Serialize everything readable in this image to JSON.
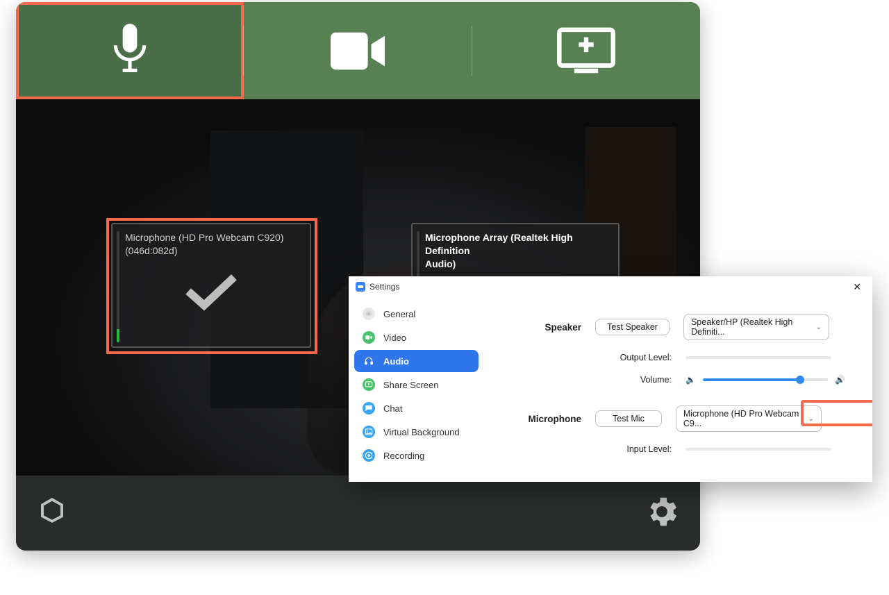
{
  "app": {
    "tabs": {
      "audio": "Audio",
      "video": "Video",
      "screen": "Add Screen"
    }
  },
  "mic_cards": {
    "left": {
      "line1": "Microphone (HD Pro Webcam C920)",
      "line2": "(046d:082d)"
    },
    "right": {
      "line1": "Microphone Array (Realtek High Definition",
      "line2": "Audio)"
    }
  },
  "settings": {
    "title": "Settings",
    "nav": {
      "general": "General",
      "video": "Video",
      "audio": "Audio",
      "share": "Share Screen",
      "chat": "Chat",
      "vbg": "Virtual Background",
      "recording": "Recording"
    },
    "speaker": {
      "label": "Speaker",
      "test_btn": "Test Speaker",
      "dropdown": "Speaker/HP (Realtek High Definiti...",
      "output_level_label": "Output Level:",
      "volume_label": "Volume:",
      "volume_percent": 78
    },
    "microphone": {
      "label": "Microphone",
      "test_btn": "Test Mic",
      "dropdown": "Microphone (HD Pro Webcam C9...",
      "input_level_label": "Input Level:"
    }
  }
}
